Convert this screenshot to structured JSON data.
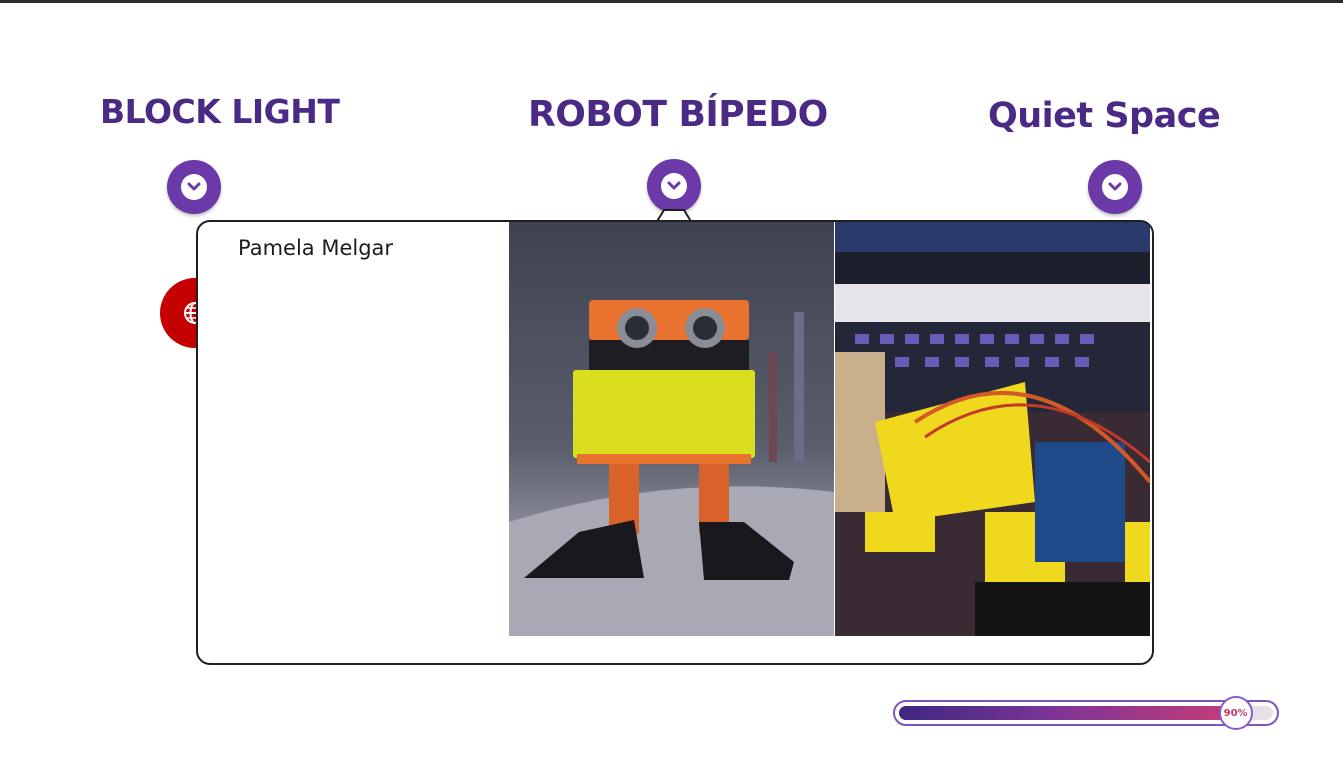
{
  "sections": [
    {
      "title": "BLOCK LIGHT",
      "toggle_icon": "chevron-down-icon"
    },
    {
      "title": "ROBOT BÍPEDO",
      "toggle_icon": "chevron-down-icon"
    },
    {
      "title": "Quiet Space",
      "toggle_icon": "chevron-down-icon"
    }
  ],
  "card": {
    "author": "Pamela Melgar",
    "photos": [
      "robot-front-photo",
      "robot-assembly-photo"
    ]
  },
  "language_button": {
    "icon": "globe-icon",
    "color": "#c40000"
  },
  "progress": {
    "value": 0.9,
    "label": "90%"
  },
  "colors": {
    "title": "#4a2a85",
    "toggle": "#6b3aa8",
    "progress_start": "#3f2780",
    "progress_end": "#c73b79"
  }
}
